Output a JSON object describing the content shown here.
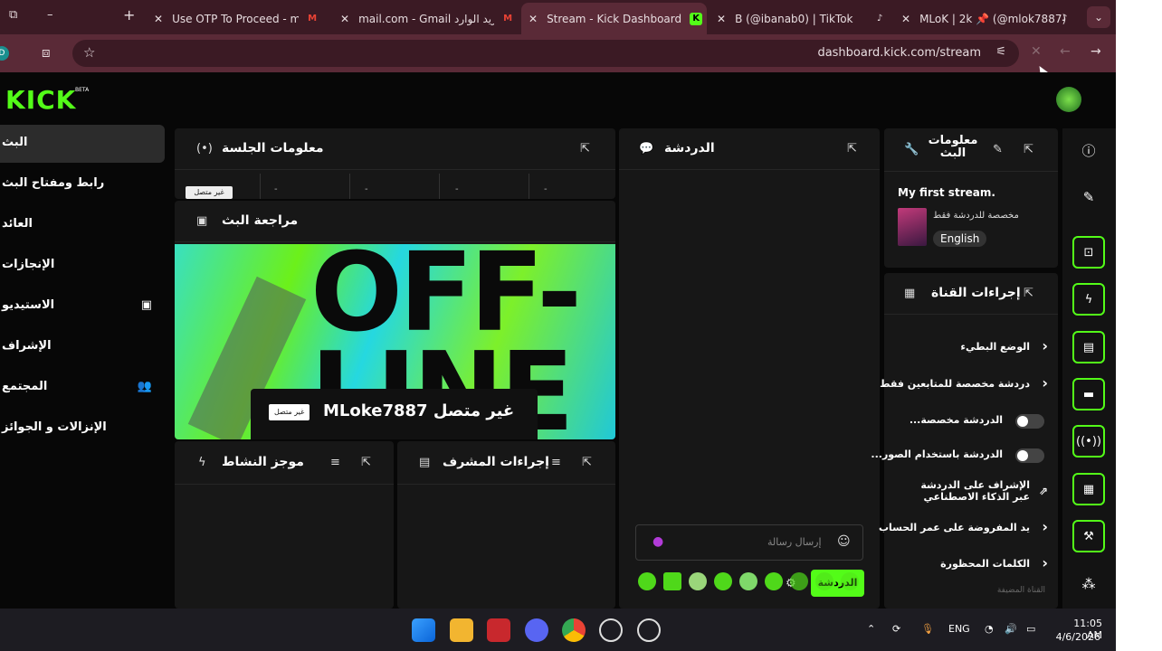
{
  "browser": {
    "tabs": [
      {
        "label": "Use OTP To Proceed - mlok",
        "fav": "M"
      },
      {
        "label": "mail.com - Gmail البريد الوارد",
        "fav": "M"
      },
      {
        "label": "Stream - Kick Dashboard",
        "fav": "K"
      },
      {
        "label": "B (@ibanab0) | TikTok",
        "fav": "♪"
      },
      {
        "label": "MLoK | 2k 📌 (@mlok7887)",
        "fav": "♪"
      }
    ],
    "url": "dashboard.kick.com/stream",
    "new_tab": "+",
    "profile_initial": "D"
  },
  "brand": {
    "logo": "KICK",
    "beta": "BETA",
    "accent": "#53fc18"
  },
  "sidebar": {
    "items": [
      {
        "label": "البث",
        "icon": ""
      },
      {
        "label": "رابط ومفتاح البث",
        "icon": ""
      },
      {
        "label": "العائد",
        "icon": ""
      },
      {
        "label": "الإنجازات",
        "icon": ""
      },
      {
        "label": "الاستيديو",
        "icon": "▣"
      },
      {
        "label": "الإشراف",
        "icon": ""
      },
      {
        "label": "المجتمع",
        "icon": "👥"
      },
      {
        "label": "الإنزالات و الجوائز",
        "icon": ""
      }
    ]
  },
  "session_panel": {
    "title": "معلومات الجلسة",
    "status_icon": "(•)",
    "stats": [
      "غير متصل",
      "-",
      "-",
      "-",
      "-"
    ]
  },
  "preview_panel": {
    "title": "مراجعة البث",
    "channel": "MLoke7887 غير متصل",
    "badge": "غير متصل",
    "bg_text": "OFF-LINE"
  },
  "activity_panel": {
    "title": "موجز النشاط"
  },
  "modactions_panel": {
    "title": "إجراءات المشرف"
  },
  "chat_panel": {
    "title": "الدردشة",
    "input_placeholder": "إرسال رسالة",
    "send_label": "الدردشة"
  },
  "stream_info": {
    "title": "معلومات البث",
    "stream_title": "My first stream.",
    "category": "مخصصة للدردشة فقط",
    "language": "English"
  },
  "channel_actions": {
    "title": "إجراءات القناة",
    "items": [
      {
        "label": "الوضع البطيء",
        "type": "chevron"
      },
      {
        "label": "دردشة مخصصة للمتابعين فقط",
        "type": "chevron"
      },
      {
        "label": "الدردشة مخصصة...",
        "type": "toggle"
      },
      {
        "label": "الدردشة باستخدام الصور...",
        "type": "toggle"
      },
      {
        "label": "الإشراف على الدردشة عبر الذكاء الاصطناعي",
        "type": "external"
      },
      {
        "label": "يد المفروضة على عمر الحساب",
        "type": "chevron"
      },
      {
        "label": "الكلمات المحظورة",
        "type": "chevron"
      }
    ],
    "footer": "القناة المضيفة"
  },
  "taskbar": {
    "lang": "ENG",
    "time": "11:05 AM",
    "date": "4/6/2026"
  }
}
